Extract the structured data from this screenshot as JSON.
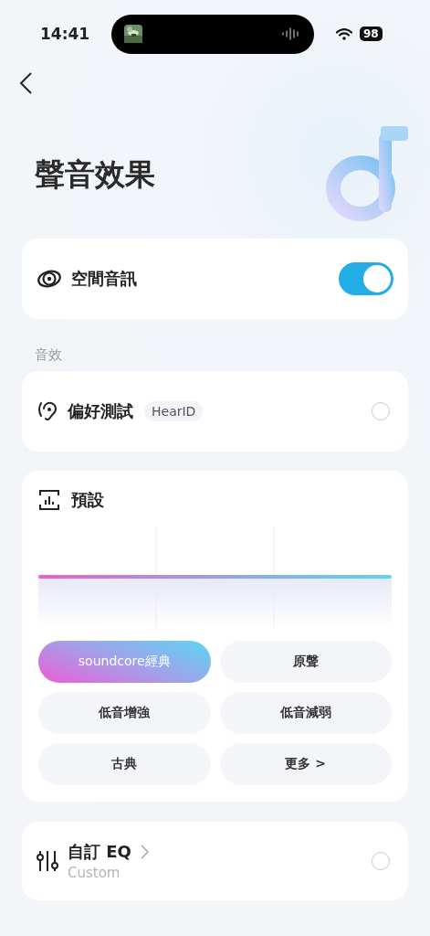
{
  "status_bar": {
    "time": "14:41",
    "battery": "98"
  },
  "page": {
    "title": "聲音效果"
  },
  "spatial_audio": {
    "label": "空間音訊",
    "on": true
  },
  "section_label": "音效",
  "hearid": {
    "label": "偏好測試",
    "tag": "HearID",
    "selected": false
  },
  "presets": {
    "title": "預設",
    "items": [
      {
        "label": "soundcore經典",
        "selected": true
      },
      {
        "label": "原聲",
        "selected": false
      },
      {
        "label": "低音增強",
        "selected": false
      },
      {
        "label": "低音減弱",
        "selected": false
      },
      {
        "label": "古典",
        "selected": false
      },
      {
        "label": "更多 >",
        "selected": false
      }
    ]
  },
  "custom_eq": {
    "label": "自訂 EQ",
    "sublabel": "Custom",
    "selected": false
  }
}
